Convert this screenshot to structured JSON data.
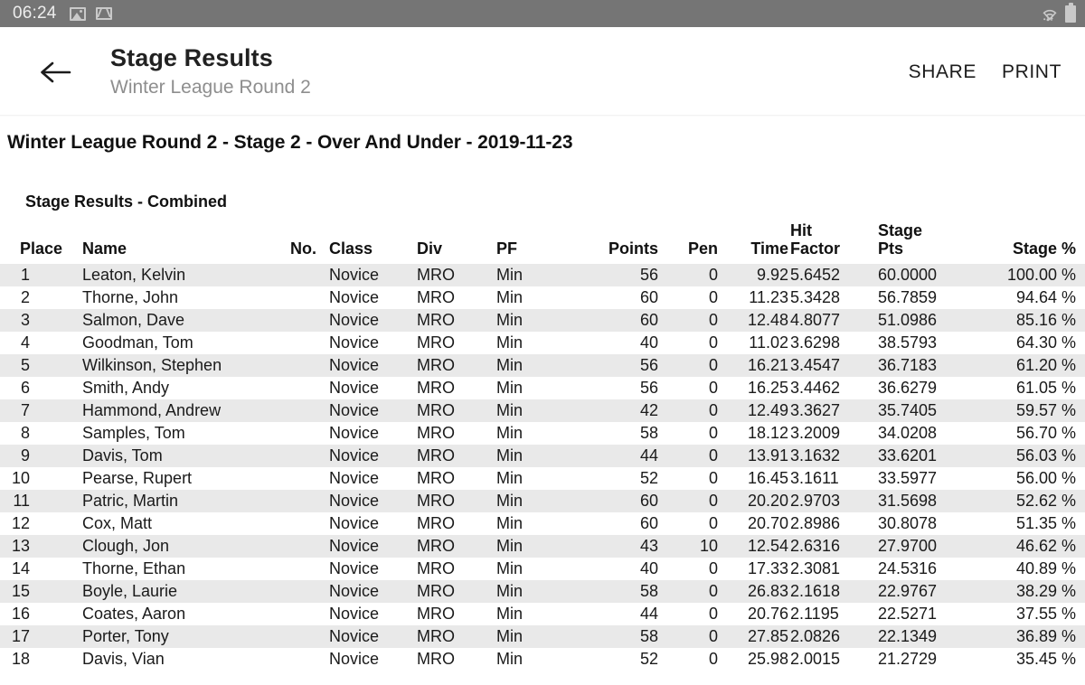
{
  "status_bar": {
    "time": "06:24",
    "left_icons": [
      "photo-icon",
      "gmail-icon"
    ],
    "right_icons": [
      "wifi-icon",
      "battery-icon"
    ],
    "background": "#757575"
  },
  "app_bar": {
    "back_icon": "arrow-left-icon",
    "title": "Stage Results",
    "subtitle": "Winter League Round 2",
    "actions": [
      {
        "label": "SHARE",
        "name": "share-button"
      },
      {
        "label": "PRINT",
        "name": "print-button"
      }
    ]
  },
  "report": {
    "title": "Winter League Round 2 - Stage 2 - Over And Under - 2019-11-23",
    "section_title": "Stage Results - Combined"
  },
  "table": {
    "headers": [
      "Place",
      "Name",
      "No.",
      "Class",
      "Div",
      "PF",
      "Points",
      "Pen",
      "Time",
      "Hit Factor",
      "Stage Pts",
      "Stage %"
    ],
    "header_hit_factor_line1": "Hit",
    "header_hit_factor_line2": "Factor",
    "header_stage_pts_line1": "Stage",
    "header_stage_pts_line2": "Pts",
    "rows": [
      {
        "place": "1",
        "name": "Leaton, Kelvin",
        "no": "",
        "class": "Novice",
        "div": "MRO",
        "pf": "Min",
        "points": "56",
        "pen": "0",
        "time": "9.92",
        "hit_factor": "5.6452",
        "stage_pts": "60.0000",
        "stage_pct": "100.00 %"
      },
      {
        "place": "2",
        "name": "Thorne, John",
        "no": "",
        "class": "Novice",
        "div": "MRO",
        "pf": "Min",
        "points": "60",
        "pen": "0",
        "time": "11.23",
        "hit_factor": "5.3428",
        "stage_pts": "56.7859",
        "stage_pct": "94.64 %"
      },
      {
        "place": "3",
        "name": "Salmon, Dave",
        "no": "",
        "class": "Novice",
        "div": "MRO",
        "pf": "Min",
        "points": "60",
        "pen": "0",
        "time": "12.48",
        "hit_factor": "4.8077",
        "stage_pts": "51.0986",
        "stage_pct": "85.16 %"
      },
      {
        "place": "4",
        "name": "Goodman, Tom",
        "no": "",
        "class": "Novice",
        "div": "MRO",
        "pf": "Min",
        "points": "40",
        "pen": "0",
        "time": "11.02",
        "hit_factor": "3.6298",
        "stage_pts": "38.5793",
        "stage_pct": "64.30 %"
      },
      {
        "place": "5",
        "name": "Wilkinson, Stephen",
        "no": "",
        "class": "Novice",
        "div": "MRO",
        "pf": "Min",
        "points": "56",
        "pen": "0",
        "time": "16.21",
        "hit_factor": "3.4547",
        "stage_pts": "36.7183",
        "stage_pct": "61.20 %"
      },
      {
        "place": "6",
        "name": "Smith, Andy",
        "no": "",
        "class": "Novice",
        "div": "MRO",
        "pf": "Min",
        "points": "56",
        "pen": "0",
        "time": "16.25",
        "hit_factor": "3.4462",
        "stage_pts": "36.6279",
        "stage_pct": "61.05 %"
      },
      {
        "place": "7",
        "name": "Hammond, Andrew",
        "no": "",
        "class": "Novice",
        "div": "MRO",
        "pf": "Min",
        "points": "42",
        "pen": "0",
        "time": "12.49",
        "hit_factor": "3.3627",
        "stage_pts": "35.7405",
        "stage_pct": "59.57 %"
      },
      {
        "place": "8",
        "name": "Samples, Tom",
        "no": "",
        "class": "Novice",
        "div": "MRO",
        "pf": "Min",
        "points": "58",
        "pen": "0",
        "time": "18.12",
        "hit_factor": "3.2009",
        "stage_pts": "34.0208",
        "stage_pct": "56.70 %"
      },
      {
        "place": "9",
        "name": "Davis, Tom",
        "no": "",
        "class": "Novice",
        "div": "MRO",
        "pf": "Min",
        "points": "44",
        "pen": "0",
        "time": "13.91",
        "hit_factor": "3.1632",
        "stage_pts": "33.6201",
        "stage_pct": "56.03 %"
      },
      {
        "place": "10",
        "name": "Pearse, Rupert",
        "no": "",
        "class": "Novice",
        "div": "MRO",
        "pf": "Min",
        "points": "52",
        "pen": "0",
        "time": "16.45",
        "hit_factor": "3.1611",
        "stage_pts": "33.5977",
        "stage_pct": "56.00 %"
      },
      {
        "place": "11",
        "name": "Patric, Martin",
        "no": "",
        "class": "Novice",
        "div": "MRO",
        "pf": "Min",
        "points": "60",
        "pen": "0",
        "time": "20.20",
        "hit_factor": "2.9703",
        "stage_pts": "31.5698",
        "stage_pct": "52.62 %"
      },
      {
        "place": "12",
        "name": "Cox, Matt",
        "no": "",
        "class": "Novice",
        "div": "MRO",
        "pf": "Min",
        "points": "60",
        "pen": "0",
        "time": "20.70",
        "hit_factor": "2.8986",
        "stage_pts": "30.8078",
        "stage_pct": "51.35 %"
      },
      {
        "place": "13",
        "name": "Clough, Jon",
        "no": "",
        "class": "Novice",
        "div": "MRO",
        "pf": "Min",
        "points": "43",
        "pen": "10",
        "time": "12.54",
        "hit_factor": "2.6316",
        "stage_pts": "27.9700",
        "stage_pct": "46.62 %"
      },
      {
        "place": "14",
        "name": "Thorne, Ethan",
        "no": "",
        "class": "Novice",
        "div": "MRO",
        "pf": "Min",
        "points": "40",
        "pen": "0",
        "time": "17.33",
        "hit_factor": "2.3081",
        "stage_pts": "24.5316",
        "stage_pct": "40.89 %"
      },
      {
        "place": "15",
        "name": "Boyle, Laurie",
        "no": "",
        "class": "Novice",
        "div": "MRO",
        "pf": "Min",
        "points": "58",
        "pen": "0",
        "time": "26.83",
        "hit_factor": "2.1618",
        "stage_pts": "22.9767",
        "stage_pct": "38.29 %"
      },
      {
        "place": "16",
        "name": "Coates, Aaron",
        "no": "",
        "class": "Novice",
        "div": "MRO",
        "pf": "Min",
        "points": "44",
        "pen": "0",
        "time": "20.76",
        "hit_factor": "2.1195",
        "stage_pts": "22.5271",
        "stage_pct": "37.55 %"
      },
      {
        "place": "17",
        "name": "Porter, Tony",
        "no": "",
        "class": "Novice",
        "div": "MRO",
        "pf": "Min",
        "points": "58",
        "pen": "0",
        "time": "27.85",
        "hit_factor": "2.0826",
        "stage_pts": "22.1349",
        "stage_pct": "36.89 %"
      },
      {
        "place": "18",
        "name": "Davis, Vian",
        "no": "",
        "class": "Novice",
        "div": "MRO",
        "pf": "Min",
        "points": "52",
        "pen": "0",
        "time": "25.98",
        "hit_factor": "2.0015",
        "stage_pts": "21.2729",
        "stage_pct": "35.45 %"
      }
    ]
  },
  "colors": {
    "status_bar": "#757575",
    "row_stripe": "#e9e9e9",
    "text_primary": "#1a1a1a",
    "text_secondary": "#8e8e8e"
  }
}
